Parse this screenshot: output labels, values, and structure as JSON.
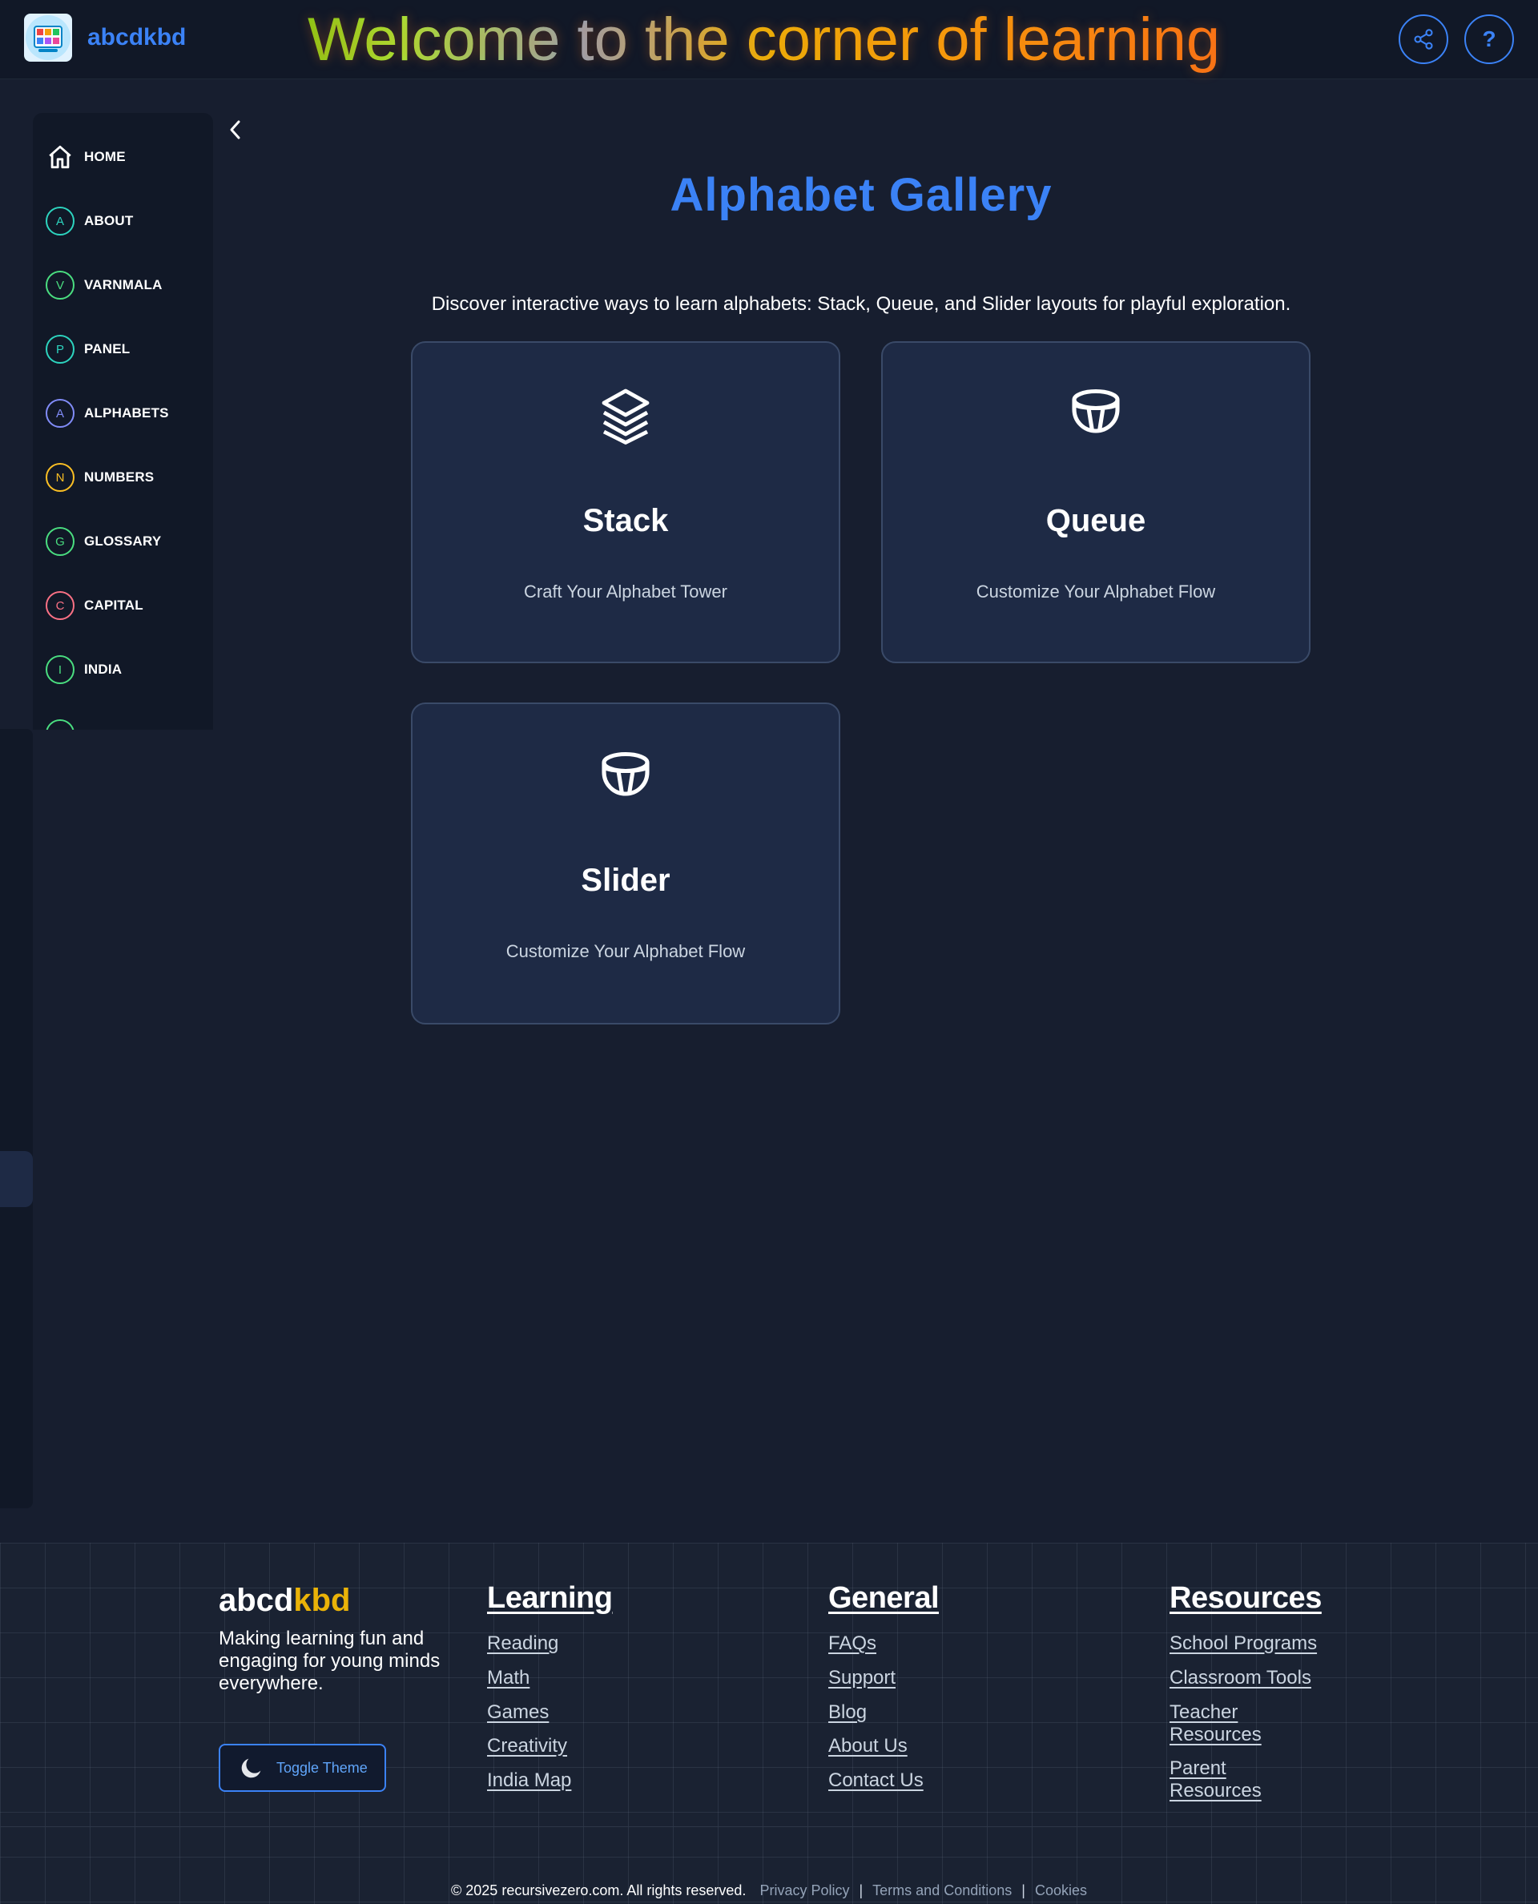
{
  "header": {
    "brand": "abcdkbd",
    "welcome": "Welcome to the corner of learning",
    "help_label": "?"
  },
  "sidebar": {
    "items": [
      {
        "letter": "",
        "label": "HOME",
        "color": "#ffffff"
      },
      {
        "letter": "A",
        "label": "ABOUT",
        "color": "#2dd4bf"
      },
      {
        "letter": "V",
        "label": "VARNMALA",
        "color": "#4ade80"
      },
      {
        "letter": "P",
        "label": "PANEL",
        "color": "#2dd4bf"
      },
      {
        "letter": "A",
        "label": "ALPHABETS",
        "color": "#818cf8"
      },
      {
        "letter": "N",
        "label": "NUMBERS",
        "color": "#fbbf24"
      },
      {
        "letter": "G",
        "label": "GLOSSARY",
        "color": "#4ade80"
      },
      {
        "letter": "C",
        "label": "CAPITAL",
        "color": "#fb7185"
      },
      {
        "letter": "I",
        "label": "INDIA",
        "color": "#4ade80"
      },
      {
        "letter": "",
        "label": "",
        "color": "#4ade80"
      }
    ]
  },
  "main": {
    "title": "Alphabet Gallery",
    "intro": "Discover interactive ways to learn alphabets: Stack, Queue, and Slider layouts for playful exploration.",
    "cards": [
      {
        "title": "Stack",
        "subtitle": "Craft Your Alphabet Tower",
        "icon": "layers-icon"
      },
      {
        "title": "Queue",
        "subtitle": "Customize Your Alphabet Flow",
        "icon": "bowl-icon"
      },
      {
        "title": "Slider",
        "subtitle": "Customize Your Alphabet Flow",
        "icon": "bowl-icon"
      }
    ]
  },
  "footer": {
    "brand_main": "abcd",
    "brand_accent": "kbd",
    "tagline": "Making learning fun and engaging for young minds everywhere.",
    "toggle_label": "Toggle Theme",
    "columns": [
      {
        "title": "Learning",
        "links": [
          "Reading",
          "Math",
          "Games",
          "Creativity",
          "India Map"
        ]
      },
      {
        "title": "General",
        "links": [
          "FAQs",
          "Support",
          "Blog",
          "About Us",
          "Contact Us"
        ]
      },
      {
        "title": "Resources",
        "links": [
          "School Programs",
          "Classroom Tools",
          "Teacher Resources",
          "Parent Resources"
        ]
      }
    ],
    "copyright": "© 2025 recursivezero.com. All rights reserved.",
    "legal_links": [
      "Privacy Policy",
      "Terms and Conditions",
      "Cookies"
    ]
  },
  "colors": {
    "accent": "#3b82f6",
    "brand_accent": "#eab308",
    "background": "#171e2f",
    "card": "#1e2a45"
  }
}
